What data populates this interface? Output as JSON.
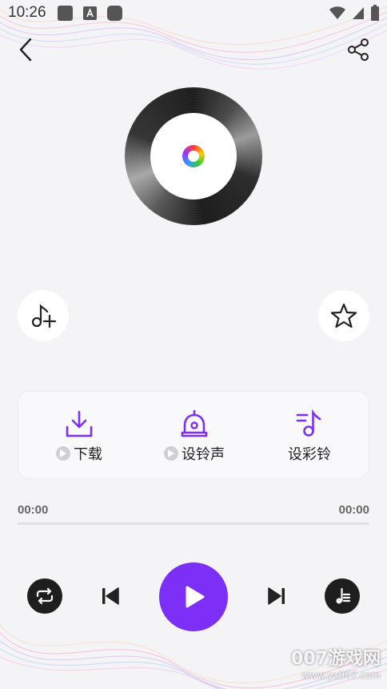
{
  "status_bar": {
    "time": "10:26"
  },
  "header": {
    "back_icon": "chevron-left-icon",
    "share_icon": "share-icon"
  },
  "actions": {
    "download_label": "下载",
    "ringtone_label": "设铃声",
    "crbt_label": "设彩铃"
  },
  "player": {
    "current_time": "00:00",
    "total_time": "00:00",
    "progress": 0
  },
  "watermark": {
    "main": "007游戏网",
    "sub": "www.yx007.com"
  },
  "colors": {
    "accent": "#7b2ff7",
    "background": "#f4f4f7",
    "dark_button": "#1e1e1e"
  }
}
